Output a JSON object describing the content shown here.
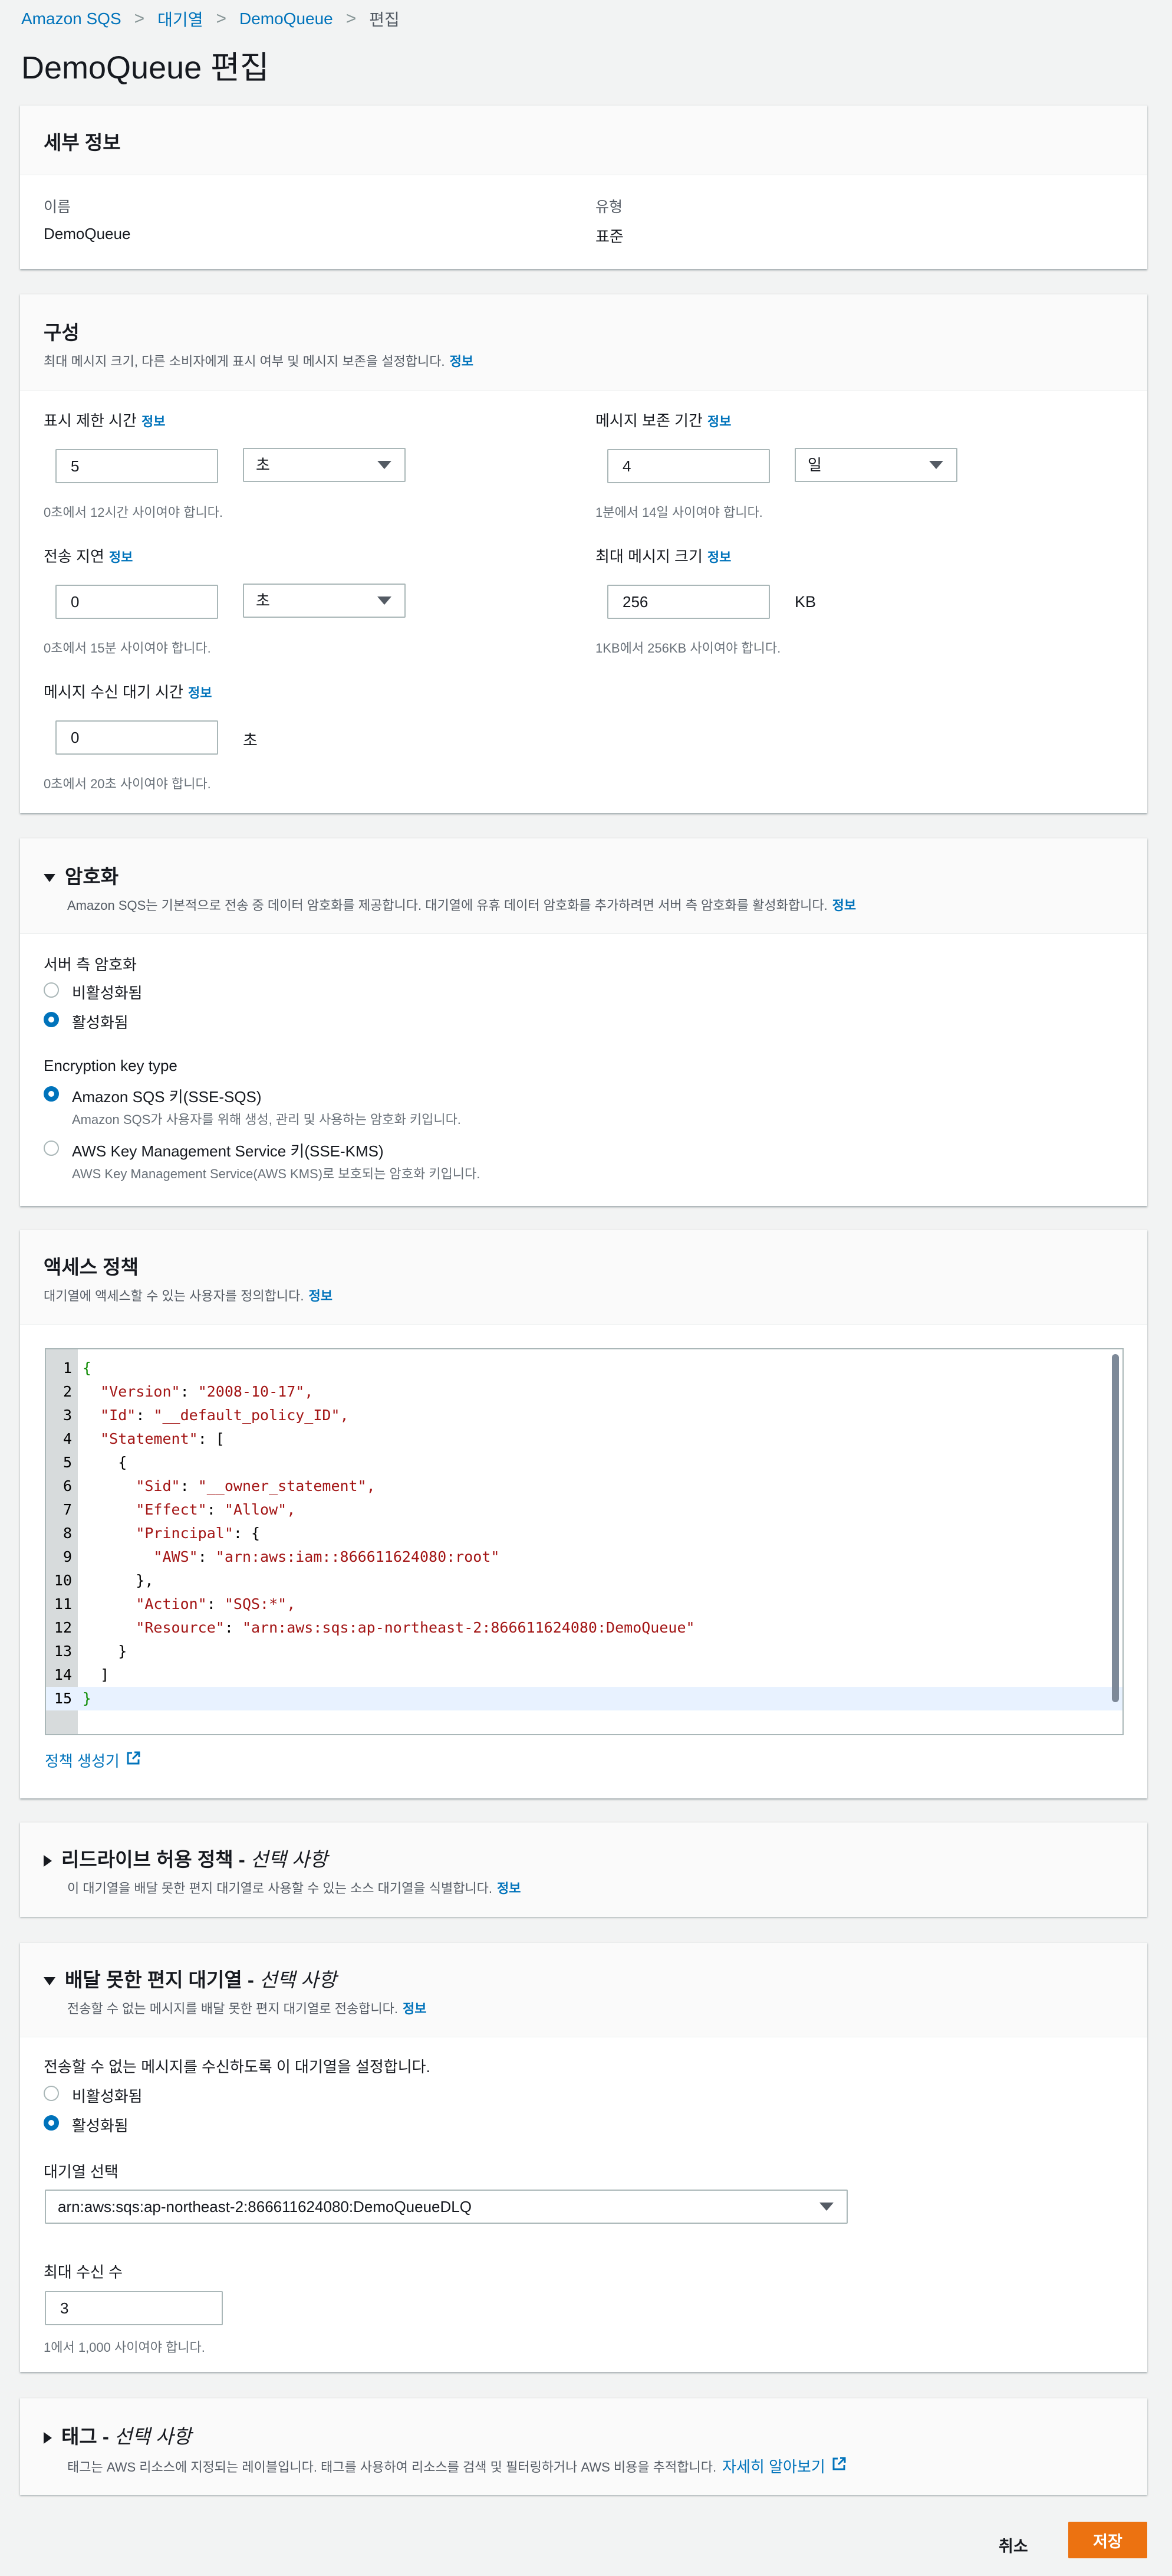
{
  "breadcrumb": {
    "items": [
      "Amazon SQS",
      "대기열",
      "DemoQueue"
    ],
    "current": "편집"
  },
  "page_title": "DemoQueue 편집",
  "details": {
    "title": "세부 정보",
    "name_label": "이름",
    "name_value": "DemoQueue",
    "type_label": "유형",
    "type_value": "표준"
  },
  "config": {
    "title": "구성",
    "desc": "최대 메시지 크기, 다른 소비자에게 표시 여부 및 메시지 보존을 설정합니다.",
    "info": "정보",
    "visibility": {
      "label": "표시 제한 시간",
      "value": "5",
      "unit": "초",
      "hint": "0초에서 12시간 사이여야 합니다."
    },
    "retention": {
      "label": "메시지 보존 기간",
      "value": "4",
      "unit": "일",
      "hint": "1분에서 14일 사이여야 합니다."
    },
    "delay": {
      "label": "전송 지연",
      "value": "0",
      "unit": "초",
      "hint": "0초에서 15분 사이여야 합니다."
    },
    "max_size": {
      "label": "최대 메시지 크기",
      "value": "256",
      "unit": "KB",
      "hint": "1KB에서 256KB 사이여야 합니다."
    },
    "receive_wait": {
      "label": "메시지 수신 대기 시간",
      "value": "0",
      "unit": "초",
      "hint": "0초에서 20초 사이여야 합니다."
    }
  },
  "encryption": {
    "title": "암호화",
    "desc": "Amazon SQS는 기본적으로 전송 중 데이터 암호화를 제공합니다. 대기열에 유휴 데이터 암호화를 추가하려면 서버 측 암호화를 활성화합니다.",
    "info": "정보",
    "sse_label": "서버 측 암호화",
    "disabled": "비활성화됨",
    "enabled": "활성화됨",
    "key_type_label": "Encryption key type",
    "sqs_key": "Amazon SQS 키(SSE-SQS)",
    "sqs_key_desc": "Amazon SQS가 사용자를 위해 생성, 관리 및 사용하는 암호화 키입니다.",
    "kms_key": "AWS Key Management Service 키(SSE-KMS)",
    "kms_key_desc": "AWS Key Management Service(AWS KMS)로 보호되는 암호화 키입니다."
  },
  "access_policy": {
    "title": "액세스 정책",
    "desc": "대기열에 액세스할 수 있는 사용자를 정의합니다.",
    "info": "정보",
    "code_lines": [
      {
        "num": "1",
        "indent": "",
        "key": "",
        "rest": "{"
      },
      {
        "num": "2",
        "indent": "  ",
        "key": "\"Version\"",
        "rest": ": \"2008-10-17\","
      },
      {
        "num": "3",
        "indent": "  ",
        "key": "\"Id\"",
        "rest": ": \"__default_policy_ID\","
      },
      {
        "num": "4",
        "indent": "  ",
        "key": "\"Statement\"",
        "rest": ": ["
      },
      {
        "num": "5",
        "indent": "    ",
        "key": "",
        "rest": "{"
      },
      {
        "num": "6",
        "indent": "      ",
        "key": "\"Sid\"",
        "rest": ": \"__owner_statement\","
      },
      {
        "num": "7",
        "indent": "      ",
        "key": "\"Effect\"",
        "rest": ": \"Allow\","
      },
      {
        "num": "8",
        "indent": "      ",
        "key": "\"Principal\"",
        "rest": ": {"
      },
      {
        "num": "9",
        "indent": "        ",
        "key": "\"AWS\"",
        "rest": ": \"arn:aws:iam::866611624080:root\""
      },
      {
        "num": "10",
        "indent": "      ",
        "key": "",
        "rest": "},"
      },
      {
        "num": "11",
        "indent": "      ",
        "key": "\"Action\"",
        "rest": ": \"SQS:*\","
      },
      {
        "num": "12",
        "indent": "      ",
        "key": "\"Resource\"",
        "rest": ": \"arn:aws:sqs:ap-northeast-2:866611624080:DemoQueue\""
      },
      {
        "num": "13",
        "indent": "    ",
        "key": "",
        "rest": "}"
      },
      {
        "num": "14",
        "indent": "  ",
        "key": "",
        "rest": "]"
      },
      {
        "num": "15",
        "indent": "",
        "key": "",
        "rest": "}"
      }
    ],
    "generator_link": "정책 생성기"
  },
  "redrive": {
    "title": "리드라이브 허용 정책 - ",
    "optional": "선택 사항",
    "desc": "이 대기열을 배달 못한 편지 대기열로 사용할 수 있는 소스 대기열을 식별합니다.",
    "info": "정보"
  },
  "dlq": {
    "title": "배달 못한 편지 대기열 - ",
    "optional": "선택 사항",
    "desc": "전송할 수 없는 메시지를 배달 못한 편지 대기열로 전송합니다.",
    "info": "정보",
    "setup_label": "전송할 수 없는 메시지를 수신하도록 이 대기열을 설정합니다.",
    "disabled": "비활성화됨",
    "enabled": "활성화됨",
    "queue_select_label": "대기열 선택",
    "queue_select_value": "arn:aws:sqs:ap-northeast-2:866611624080:DemoQueueDLQ",
    "max_receives_label": "최대 수신 수",
    "max_receives_value": "3",
    "max_receives_hint": "1에서 1,000 사이여야 합니다."
  },
  "tags": {
    "title": "태그 - ",
    "optional": "선택 사항",
    "desc": "태그는 AWS 리소스에 지정되는 레이블입니다. 태그를 사용하여 리소스를 검색 및 필터링하거나 AWS 비용을 추적합니다.",
    "learn_more": "자세히 알아보기"
  },
  "footer": {
    "cancel": "취소",
    "save": "저장"
  },
  "colors": {
    "accent": "#0073bb",
    "primary_button": "#ec7211",
    "background": "#f2f3f3"
  }
}
